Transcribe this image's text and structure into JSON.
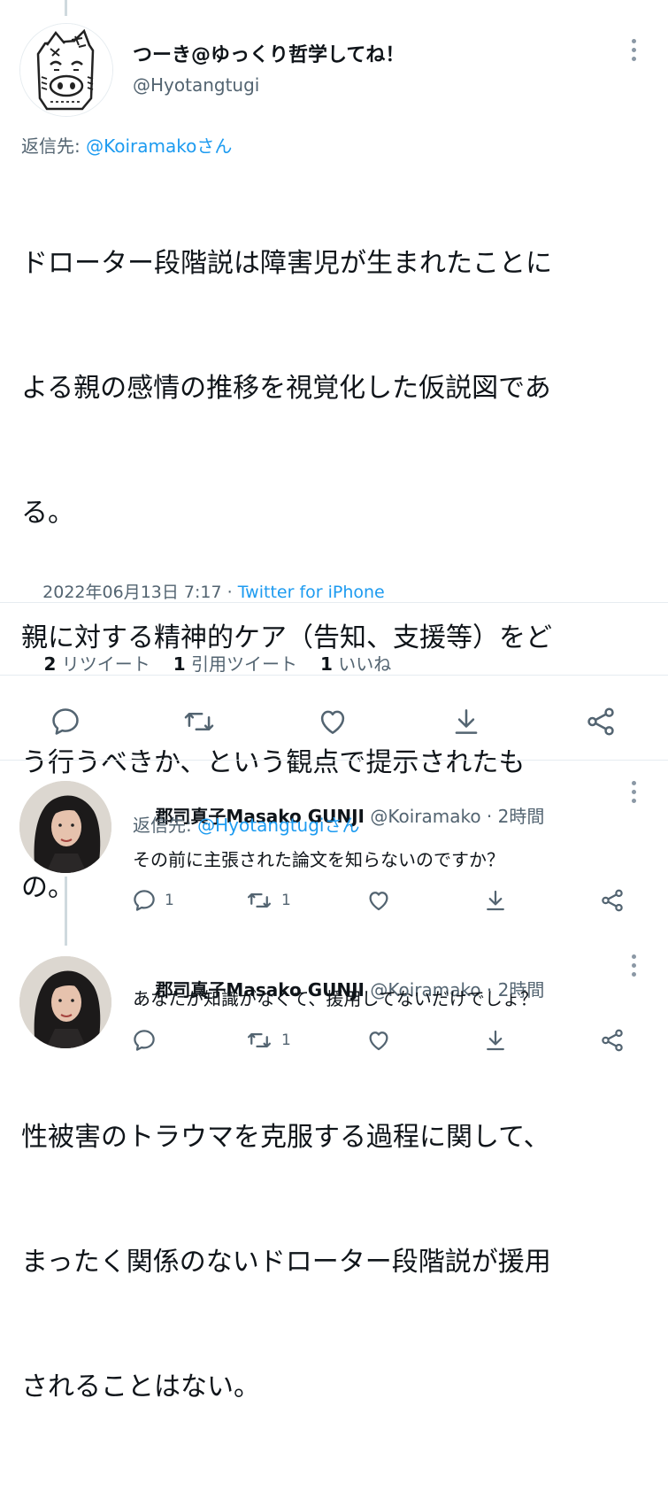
{
  "main_tweet": {
    "display_name": "つーき@ゆっくり哲学してね！",
    "handle": "@Hyotangtugi",
    "reply_prefix": "返信先: ",
    "reply_to": "@Koiramakoさん",
    "body_lines": [
      "ドローター段階説は障害児が生まれたことに",
      "よる親の感情の推移を視覚化した仮説図であ",
      "る。",
      "親に対する精神的ケア（告知、支援等）をど",
      "う行うべきか、という観点で提示されたも",
      "の。",
      "",
      "性被害のトラウマを克服する過程に関して、",
      "まったく関係のないドローター段階説が援用",
      "されることはない。"
    ],
    "timestamp": "2022年06月13日 7:17 · ",
    "source": "Twitter for iPhone",
    "stats": {
      "retweets_count": "2",
      "retweets_label": "リツイート",
      "quotes_count": "1",
      "quotes_label": "引用ツイート",
      "likes_count": "1",
      "likes_label": "いいね"
    }
  },
  "replies": [
    {
      "display_name": "郡司真子Masako GUNJI",
      "handle": "@Koiramako",
      "time": " · 2時間",
      "reply_prefix": "返信先: ",
      "reply_to": "@Hyotangtugiさん",
      "text": "その前に主張された論文を知らないのですか？",
      "reply_count": "1",
      "retweet_count": "1",
      "like_count": ""
    },
    {
      "display_name": "郡司真子Masako GUNJI",
      "handle": "@Koiramako",
      "time": " · 2時間",
      "text": "あなたが知識がなくて、援用してないだけでしょ？",
      "reply_count": "",
      "retweet_count": "1",
      "like_count": ""
    }
  ],
  "icons": {
    "reply": "reply-icon",
    "retweet": "retweet-icon",
    "like": "heart-icon",
    "bookmark": "bookmark-download-icon",
    "share": "share-icon",
    "more": "more-vertical-icon"
  },
  "colors": {
    "accent": "#1d9bf0",
    "text": "#0f1419",
    "muted": "#536471",
    "divider": "#e6ecf0"
  }
}
